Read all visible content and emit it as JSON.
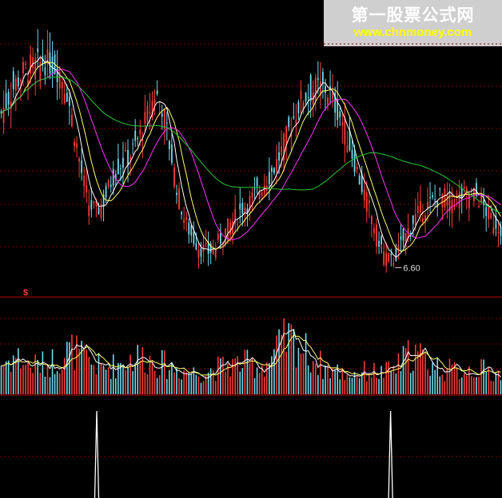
{
  "watermark": {
    "site_name": "第一股票公式网",
    "url": "www.chnmoney.com"
  },
  "colors": {
    "background": "#000000",
    "up": "#ff3b3b",
    "down": "#6fdcf0",
    "ma_fast": "#ffffff",
    "ma_mid": "#ffff66",
    "ma_slow": "#ff33ff",
    "ma_long": "#22cc33",
    "grid": "#7a0000",
    "divider": "#bb0000",
    "signal": "#ffffff"
  },
  "chart_data": [
    {
      "type": "candlestick",
      "low_annotation": {
        "label": "6.60",
        "value": 6.6
      },
      "side_marker": "$",
      "series": [
        {
          "name": "",
          "role": "ma_fast",
          "values": []
        },
        {
          "name": "",
          "role": "ma_mid",
          "values": []
        },
        {
          "name": "",
          "role": "ma_slow",
          "values": []
        },
        {
          "name": "",
          "role": "ma_long",
          "values": []
        }
      ],
      "close": [
        9.6,
        9.9,
        10.2,
        10.4,
        10.5,
        10.55,
        10.6,
        10.55,
        10.4,
        10.0,
        9.2,
        8.4,
        7.8,
        7.7,
        7.9,
        8.3,
        8.6,
        8.7,
        8.9,
        9.2,
        9.6,
        10.0,
        9.7,
        8.9,
        8.1,
        7.5,
        7.2,
        7.0,
        6.9,
        6.95,
        7.2,
        7.4,
        7.6,
        7.8,
        7.9,
        8.1,
        8.3,
        8.5,
        8.8,
        9.2,
        9.6,
        9.9,
        10.0,
        10.1,
        10.1,
        9.9,
        9.6,
        9.2,
        8.7,
        8.2,
        7.8,
        7.3,
        6.9,
        6.7,
        6.9,
        7.2,
        7.5,
        7.7,
        7.8,
        7.9,
        8.0,
        7.9,
        7.95,
        8.0,
        8.05,
        7.95,
        7.7,
        7.5,
        7.4
      ],
      "volume": [
        3.0,
        3.4,
        3.8,
        3.2,
        2.8,
        3.0,
        2.9,
        3.3,
        3.6,
        4.2,
        4.4,
        3.6,
        3.2,
        2.9,
        2.6,
        2.8,
        3.0,
        3.4,
        3.6,
        3.8,
        3.5,
        3.2,
        3.0,
        2.7,
        2.5,
        2.3,
        2.2,
        2.1,
        2.3,
        2.5,
        2.7,
        2.9,
        3.0,
        3.1,
        2.9,
        2.8,
        3.0,
        3.8,
        4.8,
        5.5,
        5.2,
        4.6,
        3.8,
        3.2,
        2.7,
        2.4,
        2.2,
        2.0,
        2.1,
        2.2,
        2.3,
        2.2,
        2.1,
        2.4,
        2.8,
        3.6,
        4.2,
        3.8,
        3.2,
        2.8,
        2.6,
        2.4,
        2.3,
        2.4,
        2.6,
        2.5,
        2.3,
        2.1,
        2.0
      ]
    },
    {
      "type": "signal",
      "values": [
        0,
        0,
        0,
        0,
        0,
        0,
        0,
        0,
        0,
        0,
        0,
        0,
        0,
        1,
        0,
        0,
        0,
        0,
        0,
        0,
        0,
        0,
        0,
        0,
        0,
        0,
        0,
        0,
        0,
        0,
        0,
        0,
        0,
        0,
        0,
        0,
        0,
        0,
        0,
        0,
        0,
        0,
        0,
        0,
        0,
        0,
        0,
        0,
        0,
        0,
        0,
        0,
        0,
        1,
        0,
        0,
        0,
        0,
        0,
        0,
        0,
        0,
        0,
        0,
        0,
        0,
        0,
        0,
        0
      ]
    }
  ]
}
